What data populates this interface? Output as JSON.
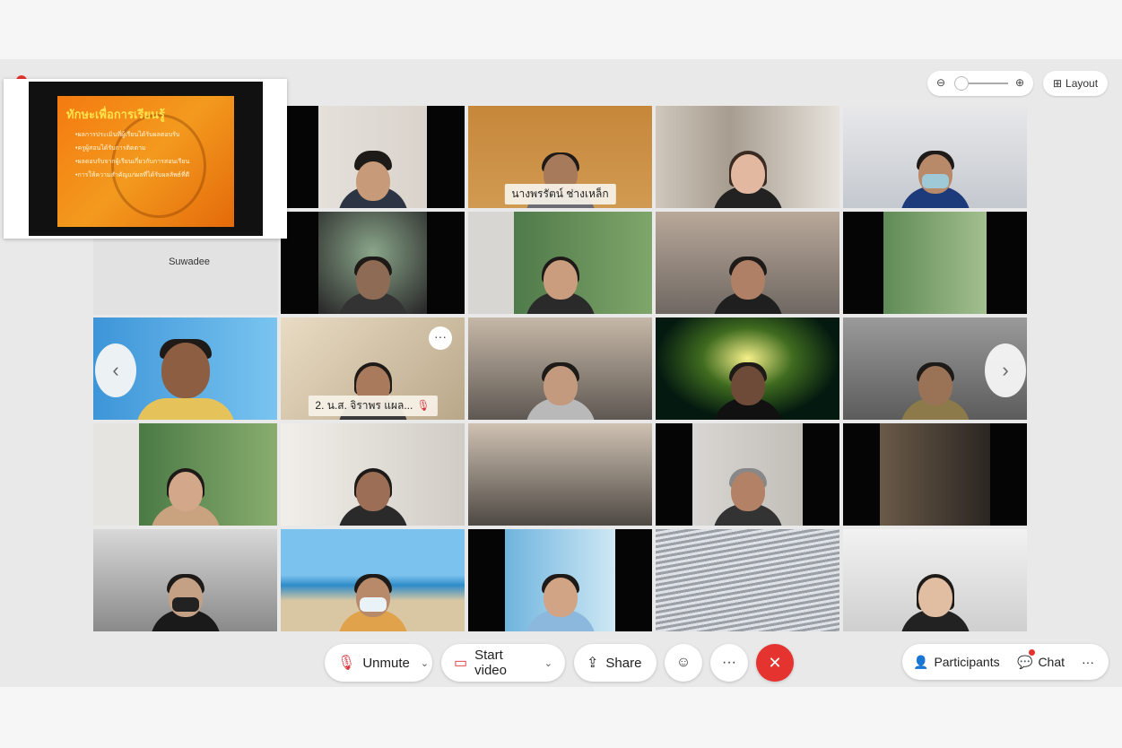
{
  "colors": {
    "accent": "#35b6e6",
    "leave": "#e5332f",
    "background": "#e9e9e9"
  },
  "top_controls": {
    "zoom_out_icon": "zoom-out-icon",
    "zoom_in_icon": "zoom-in-icon",
    "layout_label": "Layout"
  },
  "shared_content": {
    "title": "ทักษะเพื่อการเรียนรู้",
    "bullets": [
      "•ผลการประเมินที่ผู้เรียนได้รับผลตอบรับ",
      "•ครูผู้สอนได้รับการติดตาม",
      "•ผลตอบรับจากผู้เรียนเกี่ยวกับการสอนเรียน",
      "•การให้ความสำคัญแก่ผลที่ได้รับผลลัพธ์ที่ดี"
    ],
    "presenter_name": "Suwadee"
  },
  "tiles": [
    {
      "name": "",
      "muted": false
    },
    {
      "name": "นางพรรัตน์ ช่างเหล็ก",
      "muted": false
    },
    {
      "name": "",
      "muted": false
    },
    {
      "name": "",
      "muted": false
    },
    {
      "name": "",
      "muted": false
    },
    {
      "name": "",
      "muted": false
    },
    {
      "name": "",
      "muted": false
    },
    {
      "name": "",
      "muted": false
    },
    {
      "name": "",
      "muted": false
    },
    {
      "name": "2. น.ส. จิราพร แผล...",
      "muted": true
    },
    {
      "name": "",
      "muted": false
    },
    {
      "name": "",
      "muted": false
    },
    {
      "name": "",
      "muted": false
    },
    {
      "name": "",
      "muted": false
    },
    {
      "name": "",
      "muted": false
    },
    {
      "name": "",
      "muted": false
    },
    {
      "name": "",
      "muted": false
    },
    {
      "name": "",
      "muted": false
    },
    {
      "name": "",
      "muted": false
    },
    {
      "name": "",
      "muted": false
    },
    {
      "name": "",
      "muted": false
    },
    {
      "name": "",
      "muted": false
    },
    {
      "name": "",
      "muted": false
    },
    {
      "name": "",
      "muted": false
    }
  ],
  "toolbar": {
    "unmute_label": "Unmute",
    "start_video_label": "Start video",
    "share_label": "Share",
    "more_label": "···",
    "leave_label": "✕",
    "participants_label": "Participants",
    "chat_label": "Chat",
    "overflow_label": "···"
  }
}
